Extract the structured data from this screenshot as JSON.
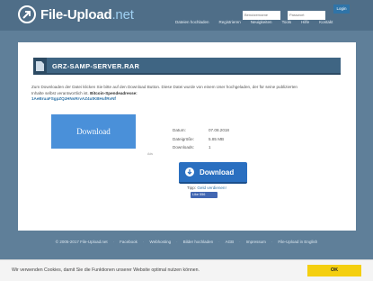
{
  "header": {
    "brand_main": "File-Upload",
    "brand_tld": ".net",
    "username_placeholder": "Benutzername",
    "password_placeholder": "Passwort",
    "login_label": "Login",
    "nav": [
      "Dateien hochladen",
      "Registrieren",
      "Neuigkeiten",
      "Tools",
      "Hilfe",
      "Kontakt"
    ]
  },
  "file": {
    "name": "GRZ-SAMP-SERVER.RAR",
    "description": "Zum Downloaden der Datei klicken Sie bitte auf den Download Button. Diese Datei wurde von einem User hochgeladen, der für seine publizierten Inhalte selbst verantwortlich ist.",
    "donation_label": "Bitcoin-Spendeadresse:",
    "donation_address": "1AeBruaFSgpZQzHNsRrvAZ4utKBHufRvNf",
    "info": [
      {
        "key": "Datum:",
        "value": "07.08.2018"
      },
      {
        "key": "Dateigröße:",
        "value": "5.85 MB"
      },
      {
        "key": "Downloads:",
        "value": "1"
      }
    ]
  },
  "ad": {
    "button_label": "Download",
    "ad_label": "Ads"
  },
  "download": {
    "label": "Download"
  },
  "tip": {
    "prefix": "Tipp:",
    "link": "Geld verdienen!"
  },
  "like": {
    "label": "Like 556"
  },
  "footer": [
    "© 2005-2017 File-Upload.net",
    "Facebook",
    "Webhosting",
    "Bilder hochladen",
    "AGB",
    "Impressum",
    "File-Upload in English"
  ],
  "cookie": {
    "text": "Wir verwenden Cookies, damit Sie die Funktionen unserer Website optimal nutzen können.",
    "ok_label": "OK"
  },
  "colors": {
    "background": "#5f7f99",
    "accent": "#2a6fc0",
    "cookie_ok": "#f4cf10"
  }
}
